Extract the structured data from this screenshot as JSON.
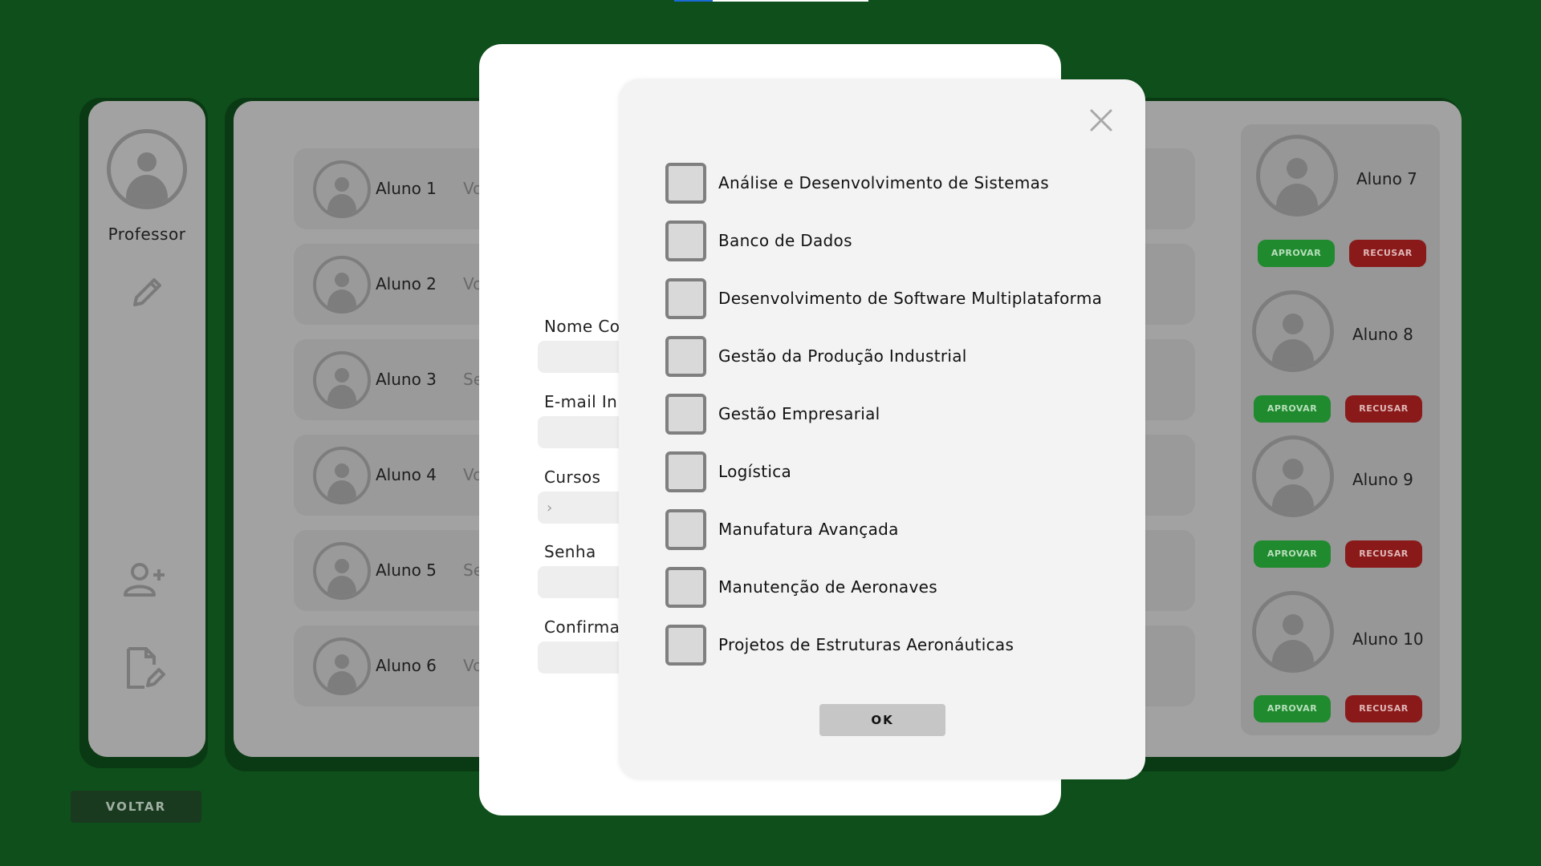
{
  "sidebar": {
    "user_label": "Professor",
    "back_label": "VOLTAR"
  },
  "students": [
    {
      "name": "Aluno 1",
      "status": "Vo"
    },
    {
      "name": "Aluno 2",
      "status": "Vo"
    },
    {
      "name": "Aluno 3",
      "status": "Se"
    },
    {
      "name": "Aluno 4",
      "status": "Vo"
    },
    {
      "name": "Aluno 5",
      "status": "Se"
    },
    {
      "name": "Aluno 6",
      "status": "Vo"
    }
  ],
  "pending": {
    "approve_label": "APROVAR",
    "reject_label": "RECUSAR",
    "items": [
      {
        "name": "Aluno 7"
      },
      {
        "name": "Aluno 8"
      },
      {
        "name": "Aluno 9"
      },
      {
        "name": "Aluno 10"
      }
    ]
  },
  "form": {
    "name_label": "Nome Co",
    "email_label": "E-mail In",
    "courses_label": "Cursos",
    "password_label": "Senha",
    "confirm_label": "Confirma"
  },
  "course_dialog": {
    "ok_label": "OK",
    "courses": [
      {
        "label": "Análise e Desenvolvimento de Sistemas",
        "checked": false
      },
      {
        "label": "Banco de Dados",
        "checked": false
      },
      {
        "label": "Desenvolvimento de Software Multiplataforma",
        "checked": false
      },
      {
        "label": "Gestão da Produção Industrial",
        "checked": false
      },
      {
        "label": "Gestão Empresarial",
        "checked": false
      },
      {
        "label": "Logística",
        "checked": false
      },
      {
        "label": "Manufatura Avançada",
        "checked": false
      },
      {
        "label": "Manutenção de Aeronaves",
        "checked": false
      },
      {
        "label": "Projetos de Estruturas Aeronáuticas",
        "checked": false
      }
    ]
  },
  "colors": {
    "background": "#0e4f1b",
    "approve": "#1f8a2e",
    "reject": "#8a1a1a"
  }
}
